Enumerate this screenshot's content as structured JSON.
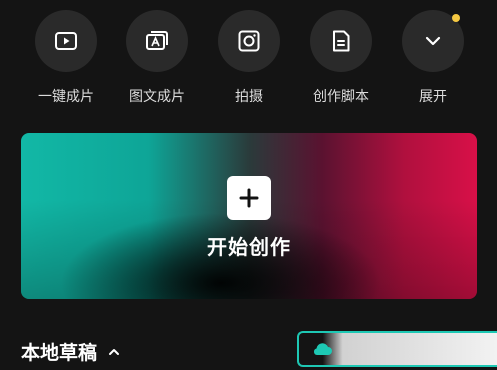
{
  "toolbar": {
    "items": [
      {
        "label": "一键成片",
        "icon": "play-video-icon"
      },
      {
        "label": "图文成片",
        "icon": "image-text-icon"
      },
      {
        "label": "拍摄",
        "icon": "camera-icon"
      },
      {
        "label": "创作脚本",
        "icon": "script-document-icon"
      },
      {
        "label": "展开",
        "icon": "chevron-down-icon"
      }
    ],
    "notification_dot_color": "#f5c842"
  },
  "create": {
    "label": "开始创作",
    "icon": "plus-icon",
    "gradient_colors": [
      "#12b8a6",
      "#000000",
      "#d81048"
    ]
  },
  "drafts": {
    "title": "本地草稿",
    "toggle_icon": "chevron-up-icon"
  },
  "cloud": {
    "icon": "cloud-icon",
    "accent": "#1ec8b4"
  }
}
